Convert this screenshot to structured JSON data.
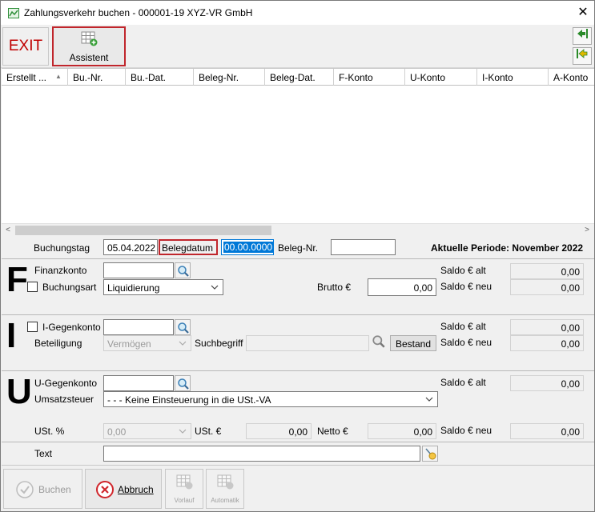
{
  "window": {
    "title": "Zahlungsverkehr buchen - 000001-19 XYZ-VR GmbH",
    "close_glyph": "✕"
  },
  "toolbar": {
    "exit_label": "EXIT",
    "assistant_label": "Assistent",
    "nav_up_glyph": "⇦",
    "nav_down_glyph": "⇦"
  },
  "grid": {
    "columns": [
      "Erstellt ...",
      "Bu.-Nr.",
      "Bu.-Dat.",
      "Beleg-Nr.",
      "Beleg-Dat.",
      "F-Konto",
      "U-Konto",
      "I-Konto",
      "A-Konto"
    ],
    "sort_glyph": "▲",
    "scroll_left_glyph": "<",
    "scroll_right_glyph": ">"
  },
  "header_row": {
    "buchungstag_label": "Buchungstag",
    "buchungstag_value": "05.04.2022",
    "belegdatum_label": "Belegdatum",
    "belegdatum_value": "00.00.0000",
    "belegnr_label": "Beleg-Nr.",
    "belegnr_value": "",
    "period_text": "Aktuelle Periode: November 2022"
  },
  "section_f": {
    "letter": "F",
    "finanzkonto_label": "Finanzkonto",
    "finanzkonto_value": "",
    "buchungsart_label": "Buchungsart",
    "buchungsart_value": "Liquidierung",
    "brutto_label": "Brutto €",
    "brutto_value": "0,00",
    "saldo_alt_label": "Saldo € alt",
    "saldo_alt_value": "0,00",
    "saldo_neu_label": "Saldo € neu",
    "saldo_neu_value": "0,00"
  },
  "section_i": {
    "letter": "I",
    "gegenkonto_label": "I-Gegenkonto",
    "gegenkonto_value": "",
    "beteiligung_label": "Beteiligung",
    "beteiligung_value": "Vermögen",
    "suchbegriff_label": "Suchbegriff",
    "suchbegriff_value": "",
    "bestand_label": "Bestand",
    "saldo_alt_label": "Saldo € alt",
    "saldo_alt_value": "0,00",
    "saldo_neu_label": "Saldo € neu",
    "saldo_neu_value": "0,00"
  },
  "section_u": {
    "letter": "U",
    "gegenkonto_label": "U-Gegenkonto",
    "gegenkonto_value": "",
    "umsatzsteuer_label": "Umsatzsteuer",
    "umsatzsteuer_value": "- - - Keine Einsteuerung in die USt.-VA",
    "ust_pct_label": "USt. %",
    "ust_pct_value": "0,00",
    "ust_eur_label": "USt. €",
    "ust_eur_value": "0,00",
    "netto_label": "Netto €",
    "netto_value": "0,00",
    "saldo_alt_label": "Saldo € alt",
    "saldo_alt_value": "0,00",
    "saldo_neu_label": "Saldo € neu",
    "saldo_neu_value": "0,00"
  },
  "text_row": {
    "label": "Text",
    "value": ""
  },
  "bottom": {
    "buchen_label": "Buchen",
    "abbruch_label": "Abbruch",
    "vorlauf_label": "Vorlauf",
    "automatik_label": "Automatik"
  },
  "colors": {
    "exit_red": "#c00000",
    "highlight_red": "#c0262c",
    "selection_blue": "#0078d7",
    "icon_green": "#2a8a2a"
  }
}
